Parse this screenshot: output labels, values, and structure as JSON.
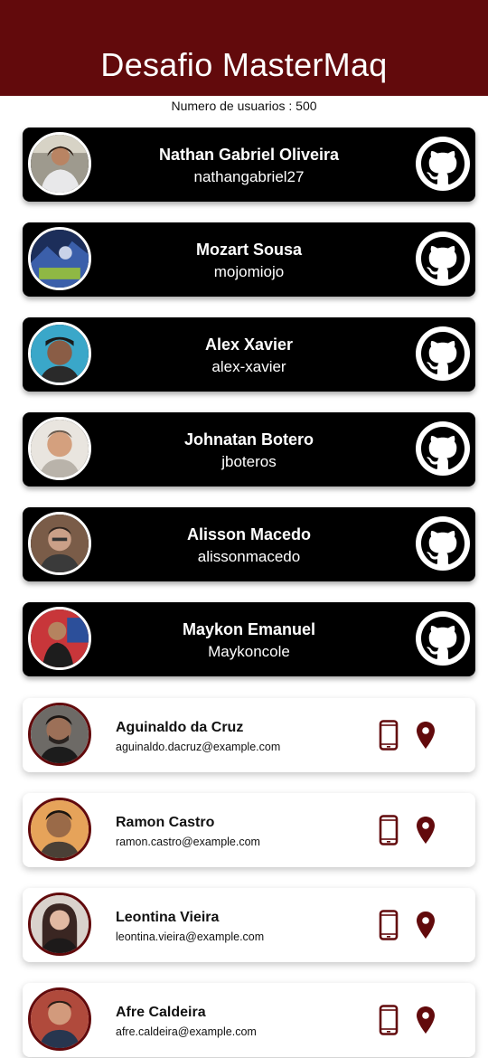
{
  "header": {
    "title": "Desafio MasterMaq"
  },
  "user_count_text": "Numero de usuarios : 500",
  "colors": {
    "brand": "#620a0c",
    "card_dark": "#000000",
    "card_light": "#ffffff",
    "text": "#111111"
  },
  "github_users": [
    {
      "name": "Nathan Gabriel Oliveira",
      "login": "nathangabriel27",
      "icon": "github-icon"
    },
    {
      "name": "Mozart Sousa",
      "login": "mojomiojo",
      "icon": "github-icon"
    },
    {
      "name": "Alex Xavier",
      "login": "alex-xavier",
      "icon": "github-icon"
    },
    {
      "name": "Johnatan Botero",
      "login": "jboteros",
      "icon": "github-icon"
    },
    {
      "name": "Alisson Macedo",
      "login": "alissonmacedo",
      "icon": "github-icon"
    },
    {
      "name": "Maykon Emanuel",
      "login": "Maykoncole",
      "icon": "github-icon"
    }
  ],
  "random_users": [
    {
      "name": "Aguinaldo da Cruz",
      "email": "aguinaldo.dacruz@example.com",
      "icons": [
        "phone-icon",
        "map-pin-icon"
      ]
    },
    {
      "name": "Ramon Castro",
      "email": "ramon.castro@example.com",
      "icons": [
        "phone-icon",
        "map-pin-icon"
      ]
    },
    {
      "name": "Leontina Vieira",
      "email": "leontina.vieira@example.com",
      "icons": [
        "phone-icon",
        "map-pin-icon"
      ]
    },
    {
      "name": "Afre Caldeira",
      "email": "afre.caldeira@example.com",
      "icons": [
        "phone-icon",
        "map-pin-icon"
      ]
    }
  ]
}
